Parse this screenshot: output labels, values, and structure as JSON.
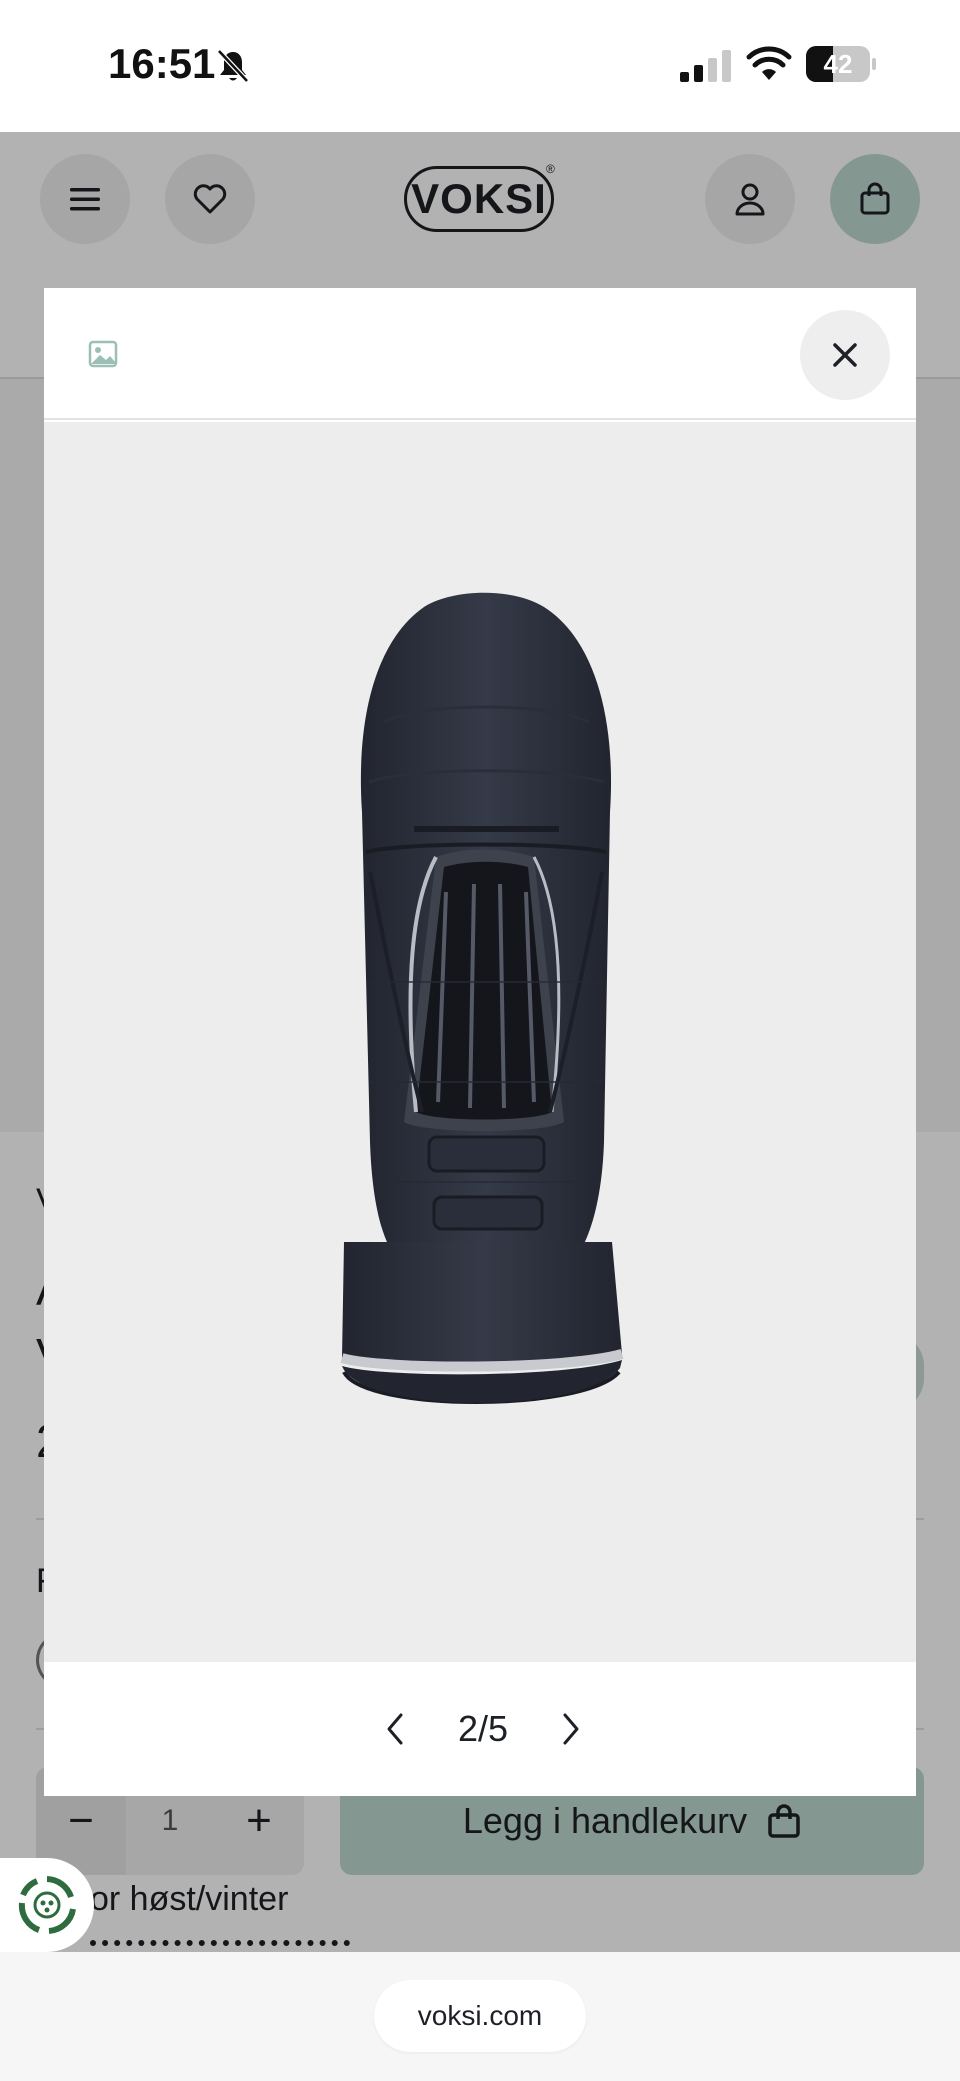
{
  "status_bar": {
    "time": "16:51",
    "battery_level": "42",
    "battery_fraction": 0.42
  },
  "header": {
    "logo_text": "VOKSI",
    "logo_mark": "®",
    "icons": [
      "menu-icon",
      "heart-icon",
      "user-icon",
      "bag-icon"
    ]
  },
  "background_page": {
    "quantity_minus": "−",
    "quantity_value": "1",
    "quantity_plus": "+",
    "add_to_cart_label": "Legg i handlekurv",
    "feature_line_1": "or høst/vinter",
    "snip_1": "V",
    "snip_2": "A",
    "snip_3": "V",
    "snip_4": "2",
    "snip_5": "F"
  },
  "modal": {
    "gallery_icon": "image-icon",
    "close_icon": "close-icon",
    "counter": "2/5",
    "image_alt": "Dark navy stroller footmuff / sleeping bag"
  },
  "browser": {
    "url": "voksi.com"
  },
  "colors": {
    "accent": "#bfd8d0",
    "dark": "#1d2026",
    "image_bg": "#ededed",
    "product": "#2b2f3c"
  }
}
